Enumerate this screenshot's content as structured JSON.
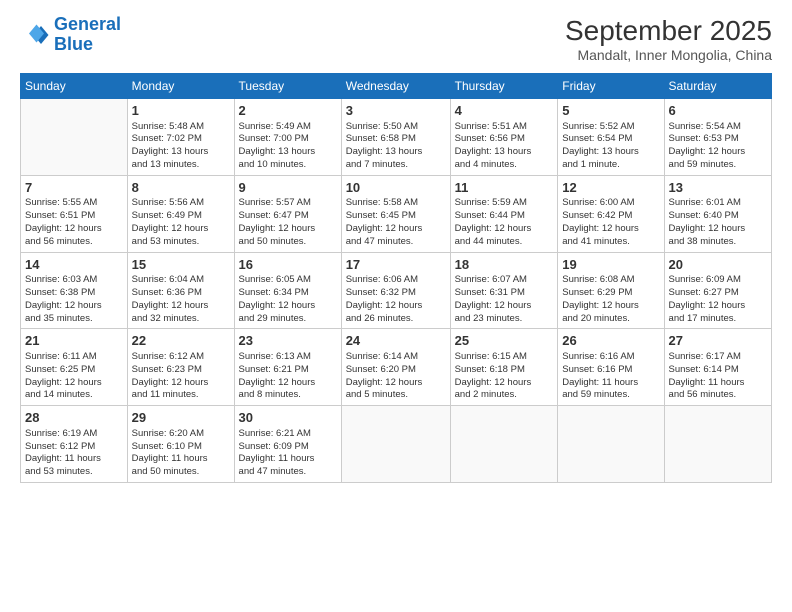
{
  "logo": {
    "line1": "General",
    "line2": "Blue"
  },
  "title": "September 2025",
  "subtitle": "Mandalt, Inner Mongolia, China",
  "weekdays": [
    "Sunday",
    "Monday",
    "Tuesday",
    "Wednesday",
    "Thursday",
    "Friday",
    "Saturday"
  ],
  "weeks": [
    [
      {
        "day": "",
        "content": ""
      },
      {
        "day": "1",
        "content": "Sunrise: 5:48 AM\nSunset: 7:02 PM\nDaylight: 13 hours\nand 13 minutes."
      },
      {
        "day": "2",
        "content": "Sunrise: 5:49 AM\nSunset: 7:00 PM\nDaylight: 13 hours\nand 10 minutes."
      },
      {
        "day": "3",
        "content": "Sunrise: 5:50 AM\nSunset: 6:58 PM\nDaylight: 13 hours\nand 7 minutes."
      },
      {
        "day": "4",
        "content": "Sunrise: 5:51 AM\nSunset: 6:56 PM\nDaylight: 13 hours\nand 4 minutes."
      },
      {
        "day": "5",
        "content": "Sunrise: 5:52 AM\nSunset: 6:54 PM\nDaylight: 13 hours\nand 1 minute."
      },
      {
        "day": "6",
        "content": "Sunrise: 5:54 AM\nSunset: 6:53 PM\nDaylight: 12 hours\nand 59 minutes."
      }
    ],
    [
      {
        "day": "7",
        "content": "Sunrise: 5:55 AM\nSunset: 6:51 PM\nDaylight: 12 hours\nand 56 minutes."
      },
      {
        "day": "8",
        "content": "Sunrise: 5:56 AM\nSunset: 6:49 PM\nDaylight: 12 hours\nand 53 minutes."
      },
      {
        "day": "9",
        "content": "Sunrise: 5:57 AM\nSunset: 6:47 PM\nDaylight: 12 hours\nand 50 minutes."
      },
      {
        "day": "10",
        "content": "Sunrise: 5:58 AM\nSunset: 6:45 PM\nDaylight: 12 hours\nand 47 minutes."
      },
      {
        "day": "11",
        "content": "Sunrise: 5:59 AM\nSunset: 6:44 PM\nDaylight: 12 hours\nand 44 minutes."
      },
      {
        "day": "12",
        "content": "Sunrise: 6:00 AM\nSunset: 6:42 PM\nDaylight: 12 hours\nand 41 minutes."
      },
      {
        "day": "13",
        "content": "Sunrise: 6:01 AM\nSunset: 6:40 PM\nDaylight: 12 hours\nand 38 minutes."
      }
    ],
    [
      {
        "day": "14",
        "content": "Sunrise: 6:03 AM\nSunset: 6:38 PM\nDaylight: 12 hours\nand 35 minutes."
      },
      {
        "day": "15",
        "content": "Sunrise: 6:04 AM\nSunset: 6:36 PM\nDaylight: 12 hours\nand 32 minutes."
      },
      {
        "day": "16",
        "content": "Sunrise: 6:05 AM\nSunset: 6:34 PM\nDaylight: 12 hours\nand 29 minutes."
      },
      {
        "day": "17",
        "content": "Sunrise: 6:06 AM\nSunset: 6:32 PM\nDaylight: 12 hours\nand 26 minutes."
      },
      {
        "day": "18",
        "content": "Sunrise: 6:07 AM\nSunset: 6:31 PM\nDaylight: 12 hours\nand 23 minutes."
      },
      {
        "day": "19",
        "content": "Sunrise: 6:08 AM\nSunset: 6:29 PM\nDaylight: 12 hours\nand 20 minutes."
      },
      {
        "day": "20",
        "content": "Sunrise: 6:09 AM\nSunset: 6:27 PM\nDaylight: 12 hours\nand 17 minutes."
      }
    ],
    [
      {
        "day": "21",
        "content": "Sunrise: 6:11 AM\nSunset: 6:25 PM\nDaylight: 12 hours\nand 14 minutes."
      },
      {
        "day": "22",
        "content": "Sunrise: 6:12 AM\nSunset: 6:23 PM\nDaylight: 12 hours\nand 11 minutes."
      },
      {
        "day": "23",
        "content": "Sunrise: 6:13 AM\nSunset: 6:21 PM\nDaylight: 12 hours\nand 8 minutes."
      },
      {
        "day": "24",
        "content": "Sunrise: 6:14 AM\nSunset: 6:20 PM\nDaylight: 12 hours\nand 5 minutes."
      },
      {
        "day": "25",
        "content": "Sunrise: 6:15 AM\nSunset: 6:18 PM\nDaylight: 12 hours\nand 2 minutes."
      },
      {
        "day": "26",
        "content": "Sunrise: 6:16 AM\nSunset: 6:16 PM\nDaylight: 11 hours\nand 59 minutes."
      },
      {
        "day": "27",
        "content": "Sunrise: 6:17 AM\nSunset: 6:14 PM\nDaylight: 11 hours\nand 56 minutes."
      }
    ],
    [
      {
        "day": "28",
        "content": "Sunrise: 6:19 AM\nSunset: 6:12 PM\nDaylight: 11 hours\nand 53 minutes."
      },
      {
        "day": "29",
        "content": "Sunrise: 6:20 AM\nSunset: 6:10 PM\nDaylight: 11 hours\nand 50 minutes."
      },
      {
        "day": "30",
        "content": "Sunrise: 6:21 AM\nSunset: 6:09 PM\nDaylight: 11 hours\nand 47 minutes."
      },
      {
        "day": "",
        "content": ""
      },
      {
        "day": "",
        "content": ""
      },
      {
        "day": "",
        "content": ""
      },
      {
        "day": "",
        "content": ""
      }
    ]
  ]
}
